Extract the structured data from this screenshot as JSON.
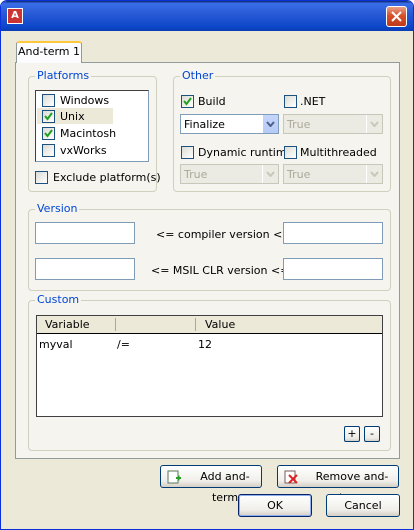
{
  "tab": {
    "label": "And-term 1"
  },
  "platforms": {
    "legend": "Platforms",
    "items": [
      {
        "label": "Windows",
        "checked": false
      },
      {
        "label": "Unix",
        "checked": true
      },
      {
        "label": "Macintosh",
        "checked": true
      },
      {
        "label": "vxWorks",
        "checked": false
      }
    ],
    "exclude": {
      "label": "Exclude platform(s)",
      "checked": false
    }
  },
  "other": {
    "legend": "Other",
    "build": {
      "label": "Build",
      "checked": true
    },
    "dotnet": {
      "label": ".NET",
      "checked": false
    },
    "build_combo": "Finalize",
    "dotnet_combo": "True",
    "dynamic_runtime": {
      "label": "Dynamic runtime",
      "checked": false
    },
    "multithreaded": {
      "label": "Multithreaded",
      "checked": false
    },
    "dynamic_combo": "True",
    "multithreaded_combo": "True"
  },
  "version": {
    "legend": "Version",
    "compiler_label": "<= compiler version <=",
    "clr_label": "<= MSIL CLR version <=",
    "compiler_min": "",
    "compiler_max": "",
    "clr_min": "",
    "clr_max": ""
  },
  "custom": {
    "legend": "Custom",
    "columns": [
      "Variable",
      "",
      "Value"
    ],
    "rows": [
      {
        "variable": "myval",
        "op": "/=",
        "value": "12"
      }
    ],
    "add_label": "+",
    "remove_label": "-"
  },
  "buttons": {
    "add_and_term": "Add and-term",
    "remove_and_term": "Remove and-term",
    "ok": "OK",
    "cancel": "Cancel"
  },
  "colors": {
    "title_bar": "#0a3cb5",
    "group_legend": "#0046d5",
    "dialog_bg": "#ece9d8"
  }
}
